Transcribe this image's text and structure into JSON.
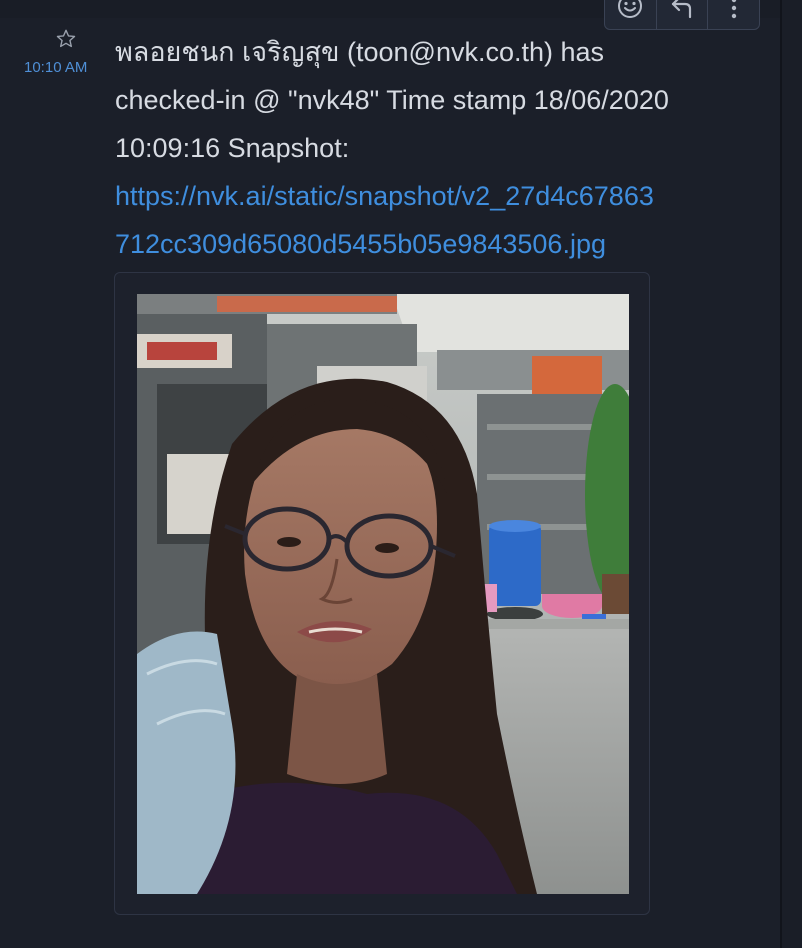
{
  "message": {
    "time": "10:10 AM",
    "line1": "พลอยชนก  เจริญสุข (toon@nvk.co.th) has",
    "line2": "checked-in @ \"nvk48\" Time stamp 18/06/2020",
    "line3": "10:09:16 Snapshot:",
    "link_line1": "https://nvk.ai/static/snapshot/v2_27d4c67863",
    "link_line2": "712cc309d65080d5455b05e9843506.jpg",
    "link_href": "https://nvk.ai/static/snapshot/v2_27d4c67863712cc309d65080d5455b05e9843506.jpg"
  },
  "icons": {
    "star": "star-icon",
    "emoji": "smiley-icon",
    "reply": "reply-icon",
    "more": "more-vertical-icon"
  },
  "colors": {
    "background": "#1b1f29",
    "text": "#d7dbe2",
    "link": "#3f8ede",
    "timestamp": "#4f8fd6",
    "toolbar_bg": "#222835",
    "border": "#3a4254"
  }
}
